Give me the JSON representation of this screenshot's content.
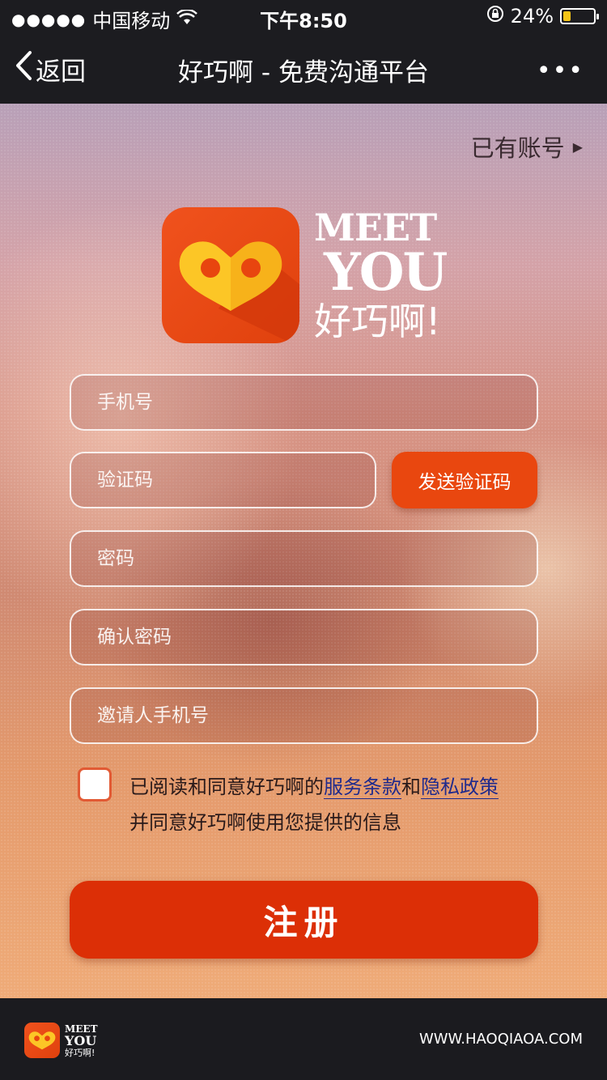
{
  "status_bar": {
    "signal_dots": "●●●●●",
    "carrier": "中国移动",
    "time": "下午8:50",
    "battery_percent": "24%",
    "battery_level": 0.24,
    "wifi_icon": "wifi-icon",
    "lock_icon": "rotation-lock-icon"
  },
  "nav": {
    "back_label": "返回",
    "title": "好巧啊 - 免费沟通平台",
    "more": "•••"
  },
  "main": {
    "login_link": "已有账号",
    "brand": {
      "meet": "MEET",
      "you": "YOU",
      "cn": "好巧啊!"
    },
    "form": {
      "phone_placeholder": "手机号",
      "code_placeholder": "验证码",
      "send_code": "发送验证码",
      "password_placeholder": "密码",
      "confirm_placeholder": "确认密码",
      "inviter_placeholder": "邀请人手机号"
    },
    "agreement": {
      "prefix": "已阅读和同意好巧啊的",
      "terms": "服务条款",
      "and": "和",
      "privacy": "隐私政策",
      "line2": "并同意好巧啊使用您提供的信息"
    },
    "register": "注册"
  },
  "footer": {
    "brand": {
      "meet": "MEET",
      "you": "YOU",
      "cn": "好巧啊!"
    },
    "url": "WWW.HAOQIAOA.COM"
  },
  "colors": {
    "accent": "#e9470f",
    "register": "#dc2f06",
    "link": "#1f2a8c",
    "bar": "#1c1c20"
  }
}
